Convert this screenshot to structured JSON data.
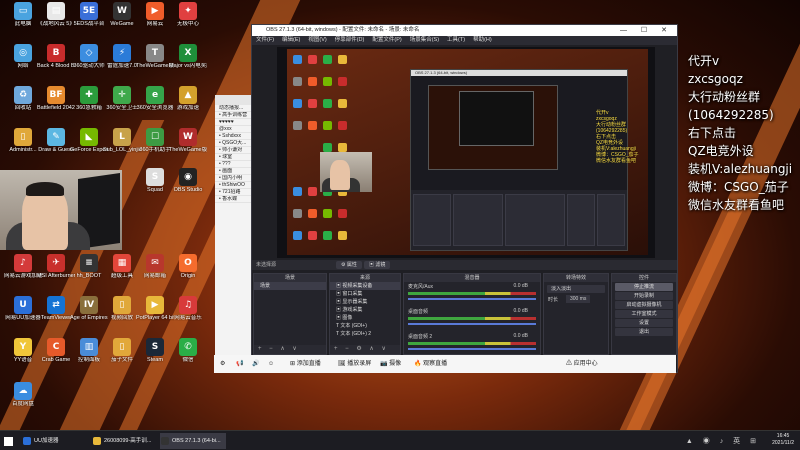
{
  "desktop_icons": [
    {
      "label": "此电脑",
      "color": "#4aa3df",
      "glyph": "▭"
    },
    {
      "label": "《战地风云 5》",
      "color": "#e8e8e8",
      "glyph": "▤"
    },
    {
      "label": "5EDS战平台",
      "color": "#3a6fd8",
      "glyph": "5E"
    },
    {
      "label": "WeGame",
      "color": "#333",
      "glyph": "W"
    },
    {
      "label": "网易云",
      "color": "#f05c2a",
      "glyph": "▶"
    },
    {
      "label": "无极中心",
      "color": "#e04040",
      "glyph": "✦"
    },
    {
      "label": "网络",
      "color": "#4aa3df",
      "glyph": "◎"
    },
    {
      "label": "Back 4 Blood Beta",
      "color": "#c82c2c",
      "glyph": "B"
    },
    {
      "label": "360驱动大师",
      "color": "#3c8de0",
      "glyph": "◇"
    },
    {
      "label": "雷霆加速7.0",
      "color": "#2b7bd8",
      "glyph": "⚡"
    },
    {
      "label": "TheWeGame版",
      "color": "#888",
      "glyph": "T"
    },
    {
      "label": "Major vs闪电奖励打开",
      "color": "#1f8f3a",
      "glyph": "X"
    },
    {
      "label": "回收站",
      "color": "#6fa8dc",
      "glyph": "♻"
    },
    {
      "label": "Battlefield 2042 Ope...",
      "color": "#e68a2e",
      "glyph": "BF"
    },
    {
      "label": "360急救箱",
      "color": "#2b9c3c",
      "glyph": "✚"
    },
    {
      "label": "360安全卫士",
      "color": "#3fa94b",
      "glyph": "✛"
    },
    {
      "label": "360安全浏览器",
      "color": "#35a54a",
      "glyph": "e"
    },
    {
      "label": "游戏加速",
      "color": "#d4a12c",
      "glyph": "▲"
    },
    {
      "label": "Administr...",
      "color": "#e0a83a",
      "glyph": "▯"
    },
    {
      "label": "Draw & Guess",
      "color": "#5cb7e2",
      "glyph": "✎"
    },
    {
      "label": "GeForce Experience",
      "color": "#76b900",
      "glyph": "◣"
    },
    {
      "label": "Sub_LOL_yinjie",
      "color": "#c8a24a",
      "glyph": "L"
    },
    {
      "label": "360手机助手",
      "color": "#3d9b43",
      "glyph": "☐"
    },
    {
      "label": "TheWeGame版",
      "color": "#b02c2c",
      "glyph": "W"
    },
    {
      "label": "CS:GO电竞全网精品",
      "color": "#e08a2a",
      "glyph": "C"
    },
    {
      "label": "小说游戏",
      "color": "#d83c3c",
      "glyph": "▣"
    },
    {
      "label": "YY开播",
      "color": "#f2d22a",
      "glyph": "Y"
    },
    {
      "label": "PotPlayer",
      "color": "#e9c44a",
      "glyph": "▶"
    },
    {
      "label": "Squad",
      "color": "#ddd",
      "glyph": "S"
    },
    {
      "label": "OBS Studio",
      "color": "#222",
      "glyph": "◉"
    },
    {
      "label": "网易云游戏加速",
      "color": "#d43a3a",
      "glyph": "♪"
    },
    {
      "label": "MSI Afterburner",
      "color": "#c9302c",
      "glyph": "✈"
    },
    {
      "label": "hh_BOOT",
      "color": "#333",
      "glyph": "≡"
    },
    {
      "label": "超级工具",
      "color": "#e2463a",
      "glyph": "▦"
    },
    {
      "label": "网易邮箱",
      "color": "#b8372c",
      "glyph": "✉"
    },
    {
      "label": "Origin",
      "color": "#f56c2d",
      "glyph": "O"
    },
    {
      "label": "网易UU加速器",
      "color": "#2b6fd8",
      "glyph": "U"
    },
    {
      "label": "TeamViewer",
      "color": "#1573d4",
      "glyph": "⇄"
    },
    {
      "label": "Age of Empires IV",
      "color": "#8a6f3c",
      "glyph": "IV"
    },
    {
      "label": "视频回放",
      "color": "#e0a83a",
      "glyph": "▯"
    },
    {
      "label": "PotPlayer 64 bit",
      "color": "#e8b83a",
      "glyph": "▶"
    },
    {
      "label": "网易云音乐",
      "color": "#d83a3a",
      "glyph": "♫"
    },
    {
      "label": "YY语音",
      "color": "#f0c63a",
      "glyph": "Y"
    },
    {
      "label": "Crab Game",
      "color": "#e65a2a",
      "glyph": "C"
    },
    {
      "label": "控制面板",
      "color": "#4a8cd8",
      "glyph": "▥"
    },
    {
      "label": "茄子文件",
      "color": "#e2a83a",
      "glyph": "▯"
    },
    {
      "label": "Steam",
      "color": "#1b2838",
      "glyph": "S"
    },
    {
      "label": "微信",
      "color": "#2aae47",
      "glyph": "✆"
    },
    {
      "label": "百度网盘",
      "color": "#3a8de0",
      "glyph": "☁"
    }
  ],
  "chat_rows": [
    "动态播报...",
    "• 高手训练营",
    "♥♥♥♥♥",
    "@xxx",
    "• Sshdxxx",
    "• QSGO大...",
    "• 帅小谦对",
    "• 球室",
    "• ???",
    "• 画面",
    "• 国内小明",
    "• thShiwOO",
    "• 721招路",
    "• 香水蝶"
  ],
  "obs": {
    "title": "OBS 27.1.3 (64-bit, windows) - 配置文件: 未命名 - 场景: 未命名",
    "menu": [
      "文件(F)",
      "编辑(E)",
      "视图(V)",
      "停靠部件(D)",
      "配置文件(P)",
      "场景集合(S)",
      "工具(T)",
      "帮助(H)"
    ],
    "window_buttons": "— ☐ ✕",
    "nested_title": "OBS 27.1.3 (64-bit, windows)",
    "nested_overlay": [
      "代开v",
      "zxcsgoqz",
      "大行动粉丝群",
      "(1064292285)",
      "右下点击",
      "QZ电竞外设",
      "装机V:alezhuangji",
      "微博：CSGO_茄子",
      "微信水友群看鱼吧"
    ],
    "scenebar": {
      "label": "未选择源",
      "btn1": "⚙ 属性",
      "btn2": "▣ 滤镜"
    },
    "docks": {
      "scenes": {
        "title": "场景",
        "items": [
          "场景"
        ],
        "footer": "+ − ∧ ∨"
      },
      "sources": {
        "title": "来源",
        "items": [
          "▣ 视频采集设备",
          "▣ 窗口采集",
          "▣ 显示器采集",
          "▣ 游戏采集",
          "▣ 图像",
          "T 文本 (GDI+)",
          "T 文本 (GDI+) 2"
        ],
        "footer": "+ − ⚙ ∧ ∨"
      },
      "mixer": {
        "title": "混音器",
        "rows": [
          {
            "name": "麦克风/Aux",
            "db": "0.0 dB"
          },
          {
            "name": "桌面音频",
            "db": "0.0 dB"
          },
          {
            "name": "桌面音频 2",
            "db": "0.0 dB"
          }
        ]
      },
      "transitions": {
        "title": "转场特效",
        "type": "淡入淡出",
        "duration_label": "时长",
        "duration": "300 ms"
      },
      "controls": {
        "title": "控件",
        "buttons": [
          "停止推流",
          "开始录制",
          "启动虚拟摄像机",
          "工作室模式",
          "设置",
          "退出"
        ]
      }
    },
    "statusbar": "⏺ 12%  ⬤ LIVE: 00:30:04  REC: 00:00:00  CPU: 3.0%, 60.00 fps  kb/s: 5"
  },
  "whitebar": {
    "items": [
      "⚙",
      "📢",
      "🔊",
      "☺",
      "⊞ 添加直播",
      "🖼 播放录屏",
      "📷 摄像",
      "🔥 观察直播",
      "⚠ 应用中心"
    ]
  },
  "overlay_text": [
    "代开v",
    "zxcsgoqz",
    "大行动粉丝群",
    "(1064292285)",
    "右下点击",
    "QZ电竞外设",
    "装机V:alezhuangji",
    "微博：CSGO_茄子",
    "微信水友群看鱼吧"
  ],
  "taskbar": {
    "items": [
      {
        "label": "UU加速器",
        "color": "#2b6fd8"
      },
      {
        "label": "26008099-高手训...",
        "color": "#e8b83a"
      },
      {
        "label": "OBS 27.1.3 (64-bi...",
        "color": "#333"
      }
    ],
    "time": "16:45",
    "date": "2021/11/2",
    "tray": "▲ ◉ ♪ 英 ⊞"
  }
}
